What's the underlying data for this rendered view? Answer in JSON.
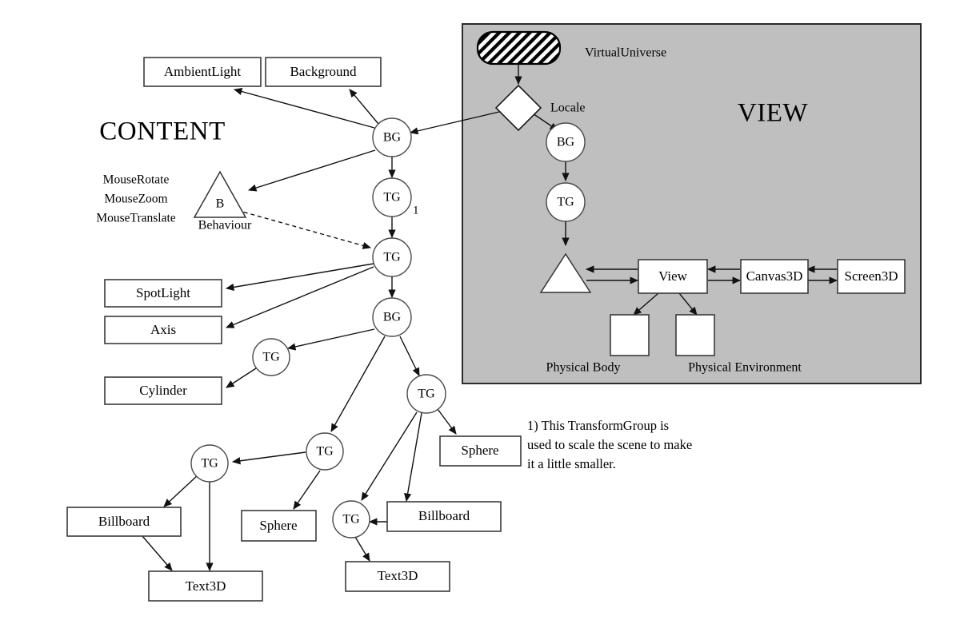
{
  "diagram": {
    "sections": {
      "content_label": "CONTENT",
      "view_label": "VIEW"
    },
    "content": {
      "boxes": {
        "ambient_light": "AmbientLight",
        "background": "Background",
        "spotlight": "SpotLight",
        "axis": "Axis",
        "cylinder": "Cylinder",
        "billboard_left": "Billboard",
        "text3d_left": "Text3D",
        "sphere_left": "Sphere",
        "sphere_right": "Sphere",
        "billboard_right": "Billboard",
        "text3d_right": "Text3D"
      },
      "nodes": {
        "bg_root": "BG",
        "tg_scale": "TG",
        "tg_mouse": "TG",
        "bg_sub": "BG",
        "tg_cylinder": "TG",
        "tg_branch_a": "TG",
        "tg_branch_b": "TG",
        "tg_branch_c": "TG",
        "tg_branch_d": "TG"
      },
      "behaviour": {
        "glyph": "B",
        "caption": "Behaviour",
        "mouse_behaviours": [
          "MouseRotate",
          "MouseZoom",
          "MouseTranslate"
        ]
      },
      "footnote_marker": "1"
    },
    "view": {
      "virtual_universe": "VirtualUniverse",
      "locale": "Locale",
      "nodes": {
        "bg": "BG",
        "tg": "TG"
      },
      "boxes": {
        "view": "View",
        "canvas3d": "Canvas3D",
        "screen3d": "Screen3D"
      },
      "captions": {
        "physical_body": "Physical Body",
        "physical_environment": "Physical Environment"
      }
    },
    "footnote": {
      "line1": "1)  This TransformGroup is",
      "line2": "used to scale the scene to make",
      "line3": "it a little smaller."
    },
    "colors": {
      "panel_fill": "#bfbfbf",
      "panel_stroke": "#2b2b2b",
      "node_fill": "#ffffff",
      "stroke": "#111111",
      "background": "#ffffff"
    }
  }
}
